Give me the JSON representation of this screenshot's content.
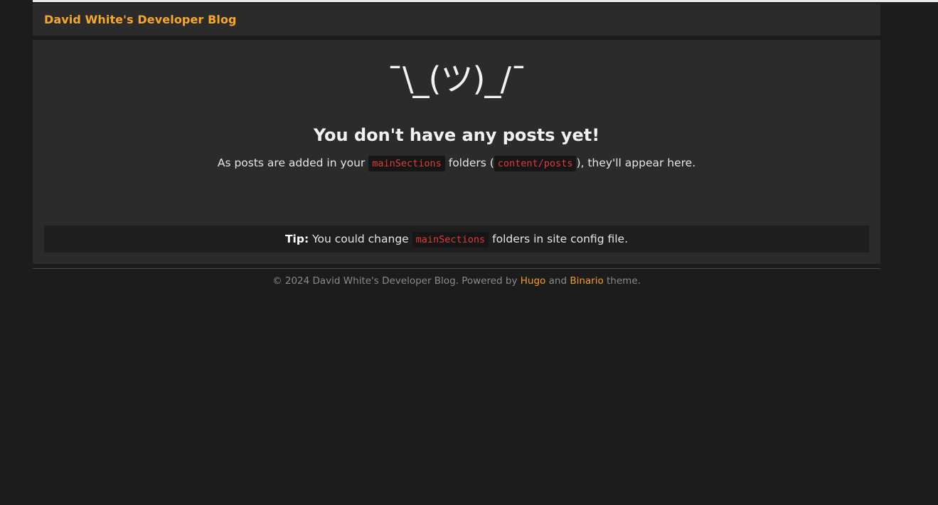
{
  "site": {
    "title": "David White's Developer Blog",
    "accent_color": "#f9a825",
    "page_background": "#1c1c1c",
    "card_background": "#2b2b2b",
    "code_color": "#e03b3b",
    "code_background": "#161616"
  },
  "header": {
    "title": "David White's Developer Blog"
  },
  "empty_state": {
    "emoticon": "¯\\_(ツ)_/¯",
    "emoticon_name": "shrug-emoticon",
    "title": "You don't have any posts yet!",
    "desc_part1": "As posts are added in your",
    "desc_code1": "mainSections",
    "desc_part2": "folders (",
    "desc_code2": "content/posts",
    "desc_part3": "), they'll appear here."
  },
  "tip": {
    "label": "Tip:",
    "text_part1": "You could change",
    "code": "mainSections",
    "text_part2": "folders in site config file."
  },
  "footer": {
    "copyright": "© 2024 David White's Developer Blog. Powered by",
    "hugo_link": "Hugo",
    "and_text": "and",
    "theme_link": "Binario",
    "theme_suffix": "theme."
  }
}
